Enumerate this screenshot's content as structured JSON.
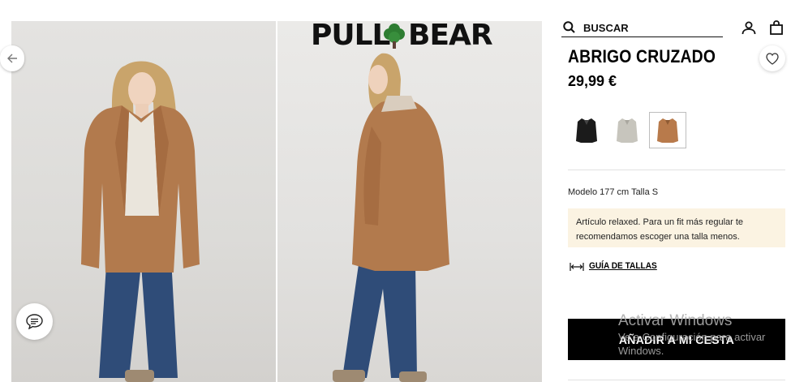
{
  "header": {
    "logo_text_left": "PULL",
    "logo_text_right": "BEAR",
    "search_placeholder": "BUSCAR"
  },
  "product": {
    "title": "ABRIGO CRUZADO",
    "price": "29,99 €",
    "colors": [
      {
        "name": "black",
        "hex": "#1b1b1b",
        "selected": false
      },
      {
        "name": "grey",
        "hex": "#c7c5bd",
        "selected": false
      },
      {
        "name": "camel",
        "hex": "#b87a4b",
        "selected": true
      }
    ],
    "model_info": "Modelo 177 cm Talla S",
    "fit_note": "Artículo relaxed. Para un fit más regular te recomendamos escoger una talla menos.",
    "size_guide_label": "GUÍA DE TALLAS",
    "add_to_cart_label": "AÑADIR A MI CESTA"
  },
  "watermark": {
    "line1": "Activar Windows",
    "line2": "Ve a Configuración para activar Windows."
  },
  "colors": {
    "coat": "#b27a4d",
    "jeans": "#2f4c78",
    "note_bg": "#fbf3e2",
    "button_bg": "#000000"
  }
}
